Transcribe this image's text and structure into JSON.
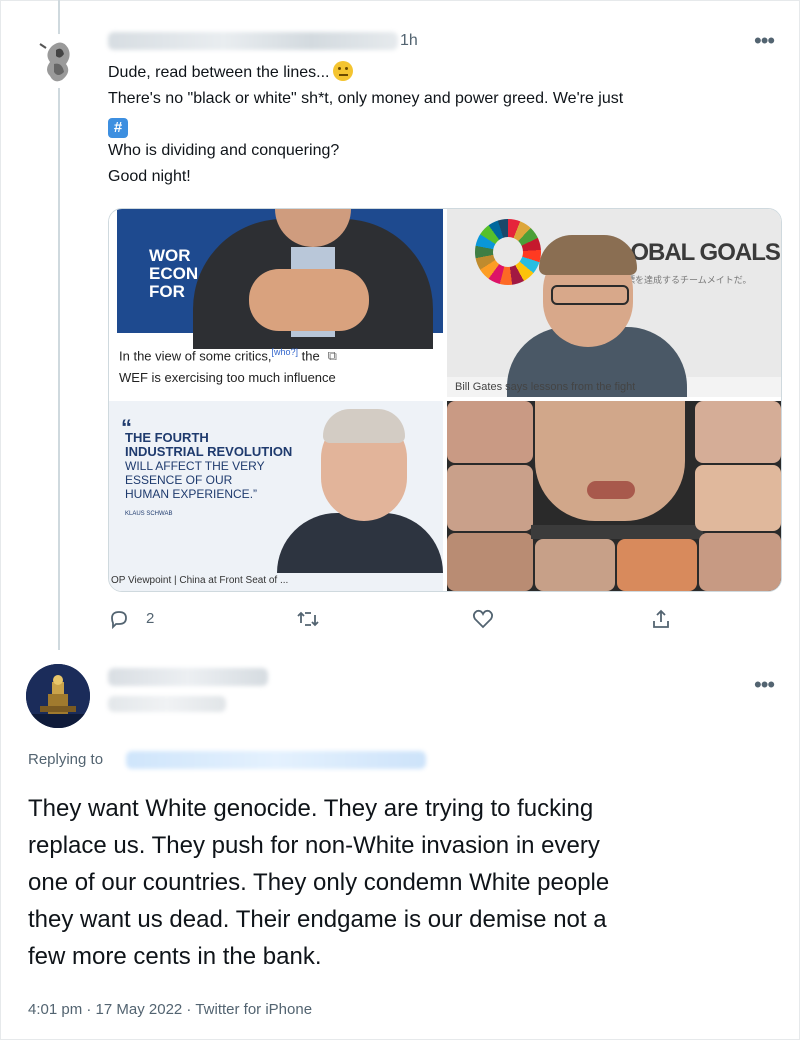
{
  "tweet1": {
    "time": "1h",
    "lines": [
      "Dude, read between the lines...",
      "There's no \"black or white\" sh*t, only money and power greed. We're just",
      "Who is dividing and conquering?",
      "Good night!"
    ],
    "media": {
      "wef_logo": [
        "WOR",
        "ECON",
        "FOR"
      ],
      "caption1_pre": "In the view of some critics,",
      "caption1_sup": "[who?]",
      "caption1_post": " the",
      "caption1_line2": "WEF is exercising too much influence",
      "goals_title": "GLOBAL GOALS",
      "goals_sub": "目標を達成するチームメイトだ。",
      "caption2": "Bill Gates says lessons from the fight",
      "quote_mark": "“",
      "quote_headline": [
        "THE FOURTH",
        "INDUSTRIAL REVOLUTION"
      ],
      "quote_body": [
        "WILL AFFECT THE VERY",
        "ESSENCE OF OUR",
        "HUMAN EXPERIENCE.”"
      ],
      "quote_name": "KLAUS SCHWAB",
      "caption3": "OP Viewpoint | China at Front Seat of ..."
    },
    "actions": {
      "replies": "2"
    }
  },
  "tweet2": {
    "replying_to_label": "Replying to",
    "text_lines": [
      "They want White genocide. They are trying to fucking",
      "replace us. They push for non-White invasion in every",
      "one of our countries. They only condemn White people",
      "they want us dead. Their endgame is our demise not a",
      "few more cents in the bank."
    ],
    "meta": "4:01 pm · 17 May 2022 · Twitter for iPhone"
  },
  "icons": {
    "more": "more-horizontal-icon",
    "reply": "reply-icon",
    "retweet": "retweet-icon",
    "like": "heart-icon",
    "share": "share-icon"
  },
  "colors": {
    "secondary_text": "#536471",
    "link_blue": "#1d9bf0",
    "thread_line": "#cfd9de"
  }
}
